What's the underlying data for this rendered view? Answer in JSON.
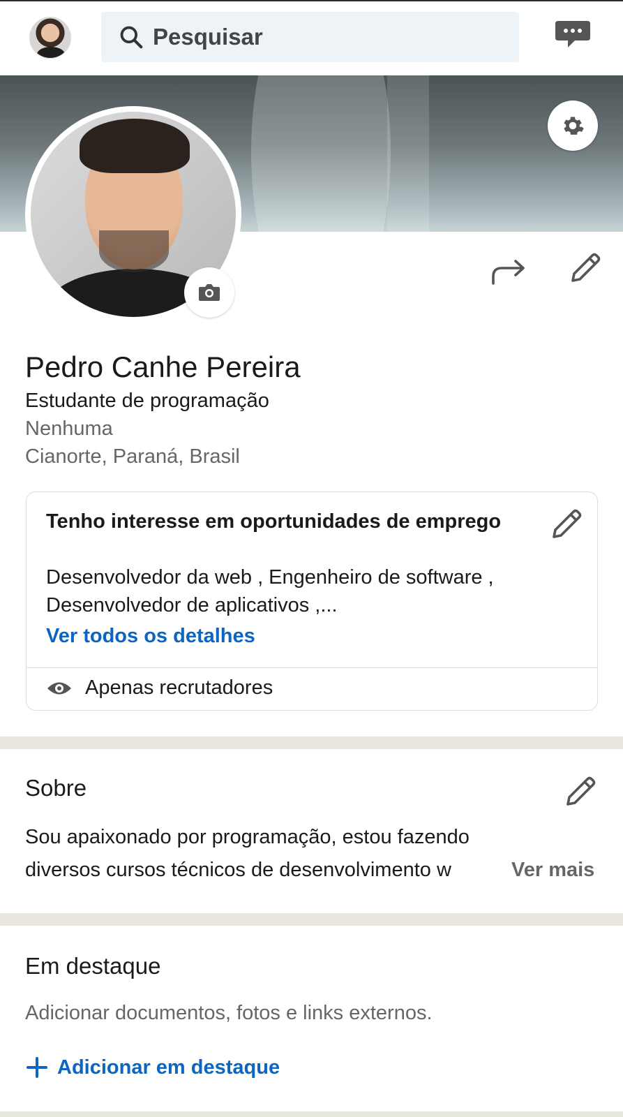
{
  "header": {
    "search_placeholder": "Pesquisar"
  },
  "profile": {
    "name": "Pedro Canhe Pereira",
    "headline": "Estudante de programação",
    "company": "Nenhuma",
    "location": "Cianorte, Paraná, Brasil"
  },
  "open_to_work": {
    "title": "Tenho interesse em oportunidades de emprego",
    "description": "Desenvolvedor da web , Engenheiro de software , Desenvolvedor de aplicativos ,...",
    "link": "Ver todos os detalhes",
    "visibility": "Apenas recrutadores"
  },
  "about": {
    "title": "Sobre",
    "line1": "Sou apaixonado por programação, estou fazendo",
    "line2": "diversos cursos técnicos de desenvolvimento w",
    "more": "Ver mais"
  },
  "featured": {
    "title": "Em destaque",
    "description": "Adicionar documentos, fotos e links externos.",
    "add_label": "Adicionar em destaque"
  },
  "colors": {
    "link_blue": "#0a66c2",
    "separator": "#e9e5df",
    "search_bg": "#eef3f8"
  },
  "icons": [
    "search-icon",
    "message-icon",
    "gear-icon",
    "camera-icon",
    "share-icon",
    "pencil-icon",
    "eye-icon",
    "plus-icon"
  ]
}
